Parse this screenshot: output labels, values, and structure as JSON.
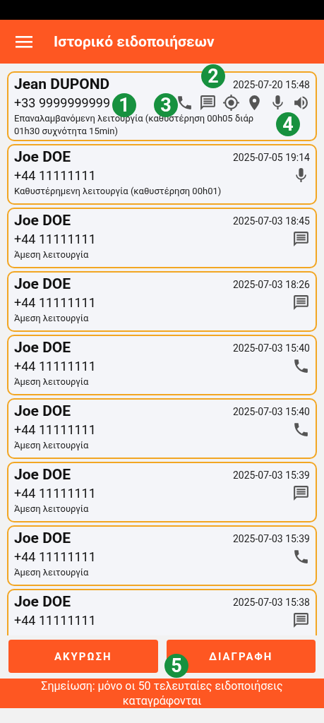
{
  "header": {
    "title": "Ιστορικό ειδοποιήσεων"
  },
  "entries": [
    {
      "name": "Jean DUPOND",
      "date": "2025-07-20 15:48",
      "phone": "+33 9999999999",
      "description": [
        "Επαναλαμβανόμενη λειτουργία (καθυστέρηση 00h05 διάρ",
        "01h30 συχνότητα 15min)"
      ],
      "icons": [
        {
          "kind": "call"
        },
        {
          "kind": "message"
        },
        {
          "kind": "gps"
        },
        {
          "kind": "pin"
        },
        {
          "kind": "mic"
        },
        {
          "kind": "speaker"
        }
      ]
    },
    {
      "name": "Joe DOE",
      "date": "2025-07-05 19:14",
      "phone": "+44 11111111",
      "description": [
        "Καθυστέρημενη λειτουργία (καθυστέρηση 00h01)"
      ],
      "icons": [
        {
          "kind": "mic"
        }
      ]
    },
    {
      "name": "Joe DOE",
      "date": "2025-07-03 18:45",
      "phone": "+44 11111111",
      "description": [
        "Άμεση λειτουργία"
      ],
      "icons": [
        {
          "kind": "message"
        }
      ]
    },
    {
      "name": "Joe DOE",
      "date": "2025-07-03 18:26",
      "phone": "+44 11111111",
      "description": [
        "Άμεση λειτουργία"
      ],
      "icons": [
        {
          "kind": "message"
        }
      ]
    },
    {
      "name": "Joe DOE",
      "date": "2025-07-03 15:40",
      "phone": "+44 11111111",
      "description": [
        "Άμεση λειτουργία"
      ],
      "icons": [
        {
          "kind": "call"
        }
      ]
    },
    {
      "name": "Joe DOE",
      "date": "2025-07-03 15:40",
      "phone": "+44 11111111",
      "description": [
        "Άμεση λειτουργία"
      ],
      "icons": [
        {
          "kind": "call"
        }
      ]
    },
    {
      "name": "Joe DOE",
      "date": "2025-07-03 15:39",
      "phone": "+44 11111111",
      "description": [
        "Άμεση λειτουργία"
      ],
      "icons": [
        {
          "kind": "message"
        }
      ]
    },
    {
      "name": "Joe DOE",
      "date": "2025-07-03 15:39",
      "phone": "+44 11111111",
      "description": [
        "Άμεση λειτουργία"
      ],
      "icons": [
        {
          "kind": "call"
        }
      ]
    },
    {
      "name": "Joe DOE",
      "date": "2025-07-03 15:38",
      "phone": "+44 11111111",
      "icons": [
        {
          "kind": "message"
        }
      ]
    }
  ],
  "buttons": [
    "ΑΚΥΡΩΣΗ",
    "ΔΙΑΓΡΑΦΗ"
  ],
  "note": "Σημείωση: μόνο οι 50 τελευταίες ειδοποιήσεις καταγράφονται",
  "callouts": [
    "1",
    "2",
    "3",
    "4",
    "5"
  ]
}
